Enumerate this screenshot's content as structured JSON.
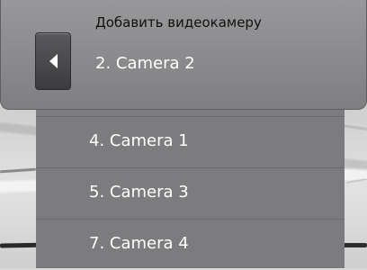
{
  "header": {
    "title": "Добавить видеокамеру",
    "selected_camera": "2. Camera 2",
    "back_icon": "chevron-left-icon"
  },
  "cameras": [
    {
      "label": "4. Camera 1"
    },
    {
      "label": "5. Camera 3"
    },
    {
      "label": "7. Camera 4"
    }
  ],
  "colors": {
    "panel": "#7c7c7e",
    "header": "#8c8c8e",
    "button": "#444446",
    "text": "#ffffff",
    "title_text": "#111111"
  }
}
